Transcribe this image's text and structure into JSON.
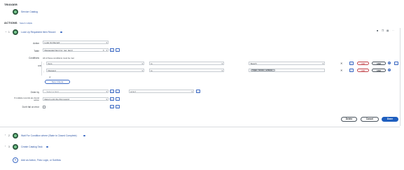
{
  "trigger": {
    "heading": "TRIGGER",
    "name": "Service Catalog"
  },
  "actions": {
    "heading": "ACTIONS",
    "select_multiple": "Select multiple",
    "step1": {
      "index": "1",
      "title": "Look Up Requested Item Record",
      "action": {
        "label": "Action",
        "value": "Look Up Record"
      },
      "table": {
        "label": "Table",
        "value": "Requested Item [sc_req_item]"
      },
      "conditions": {
        "label": "Conditions",
        "hint": "All of these conditions must be met",
        "rows": [
          {
            "connector": "AND",
            "field": "Item",
            "operator": "is",
            "value": "Sketch"
          },
          {
            "connector": "",
            "field": "Request",
            "operator": "is",
            "value": "",
            "pill_text": "Trigger - Service ... ▸ Reque..."
          }
        ],
        "or_text": "or",
        "new_criteria": "New Criteria",
        "or_btn": "OR",
        "and_btn": "AND"
      },
      "order_by": {
        "label": "Order by",
        "placeholder": "-- Select a field",
        "sort": "a to z"
      },
      "multiple": {
        "label": "If multiple records are found action",
        "value": "Return only the first record"
      },
      "dont_fail": {
        "label": "Don't fail on error"
      },
      "buttons": {
        "delete": "Delete",
        "cancel": "Cancel",
        "done": "Done"
      }
    },
    "step2": {
      "index": "2",
      "title": "Wait For Condition where (State is Closed Complete)"
    },
    "step3": {
      "index": "3",
      "title": "Create Catalog Task"
    },
    "add": "Add an Action, Flow Logic, or Subflow"
  }
}
